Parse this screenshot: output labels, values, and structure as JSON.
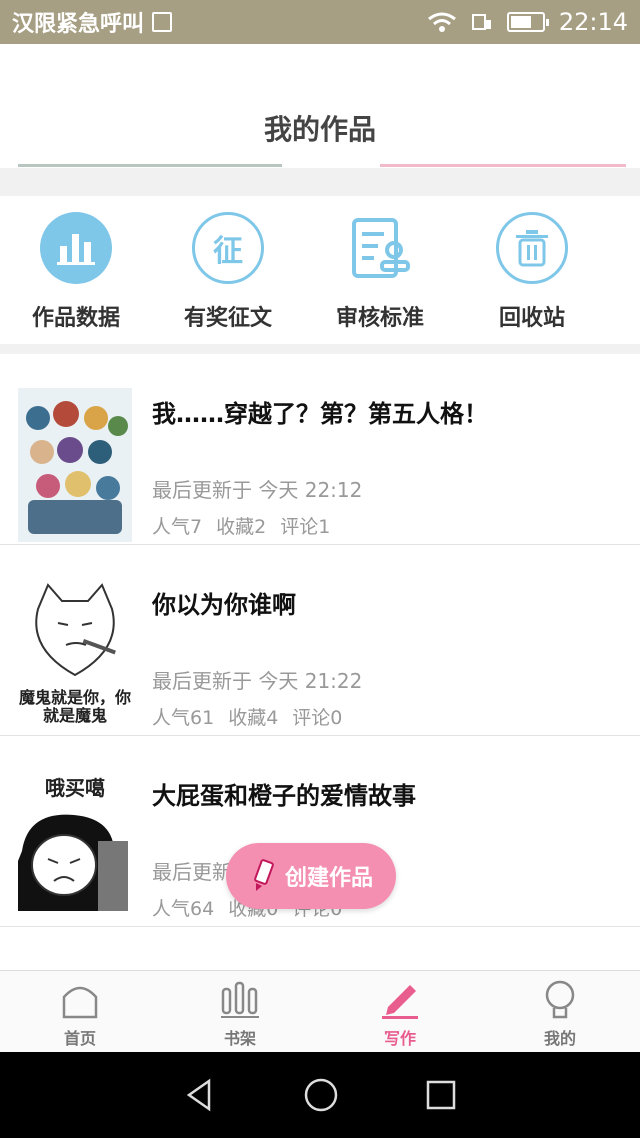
{
  "status": {
    "carrier": "汉限紧急呼叫",
    "time": "22:14"
  },
  "header": {
    "title": "我的作品"
  },
  "tools": [
    {
      "label": "作品数据",
      "icon": "bar-chart-icon"
    },
    {
      "label": "有奖征文",
      "icon": "zheng-badge-icon",
      "glyph": "征"
    },
    {
      "label": "审核标准",
      "icon": "review-doc-icon"
    },
    {
      "label": "回收站",
      "icon": "trash-icon"
    }
  ],
  "works": [
    {
      "title": "我……穿越了？第？第五人格！",
      "updated": "最后更新于 今天 22:12",
      "popularity": "人气7",
      "favorites": "收藏2",
      "comments": "评论1"
    },
    {
      "title": "你以为你谁啊",
      "updated": "最后更新于 今天 21:22",
      "popularity": "人气61",
      "favorites": "收藏4",
      "comments": "评论0",
      "thumb_caption": "魔鬼就是你，你就是魔鬼"
    },
    {
      "title": "大屁蛋和橙子的爱情故事",
      "updated": "最后更新于 今天",
      "popularity": "人气64",
      "favorites": "收藏0",
      "comments": "评论0",
      "thumb_caption": "哦买噶"
    }
  ],
  "fab": {
    "label": "创建作品"
  },
  "tabs": [
    {
      "label": "首页",
      "icon": "home-icon",
      "active": false
    },
    {
      "label": "书架",
      "icon": "bookshelf-icon",
      "active": false
    },
    {
      "label": "写作",
      "icon": "pencil-icon",
      "active": true
    },
    {
      "label": "我的",
      "icon": "profile-icon",
      "active": false
    }
  ],
  "colors": {
    "statusbar": "#a79f83",
    "accent": "#e85c8e",
    "fab": "#f48fb1",
    "tool_blue": "#7fc7e8"
  }
}
